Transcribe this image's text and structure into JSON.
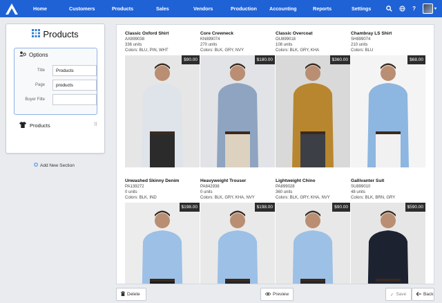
{
  "app": {
    "logo_icon": "app-logo-icon",
    "accent": "#1f62d6"
  },
  "nav": {
    "items": [
      "Home",
      "Customers",
      "Products",
      "Sales",
      "Vendors",
      "Production",
      "Accounting",
      "Reports",
      "Settings"
    ]
  },
  "topbar_icons": [
    "search-icon",
    "globe-icon",
    "help-icon"
  ],
  "panel": {
    "title": "Products",
    "options_label": "Options",
    "fields": [
      {
        "label": "Title",
        "value": "Products"
      },
      {
        "label": "Page",
        "value": "products"
      },
      {
        "label": "Buyer Filte",
        "value": ""
      }
    ],
    "section_label": "Products",
    "add_section": "Add New Section"
  },
  "products": [
    {
      "name": "Classic Oxford Shirt",
      "sku": "AX899038",
      "units": "336 units",
      "colors": "Colors: BLU, PIN, WHT",
      "price": "$90.00",
      "top": "#dfe3ea",
      "bottom": "#2b2b2b",
      "bg": "#e6e6e6"
    },
    {
      "name": "Core Crewneck",
      "sku": "KN899074",
      "units": "270 units",
      "colors": "Colors: BLK, GRY, NVY",
      "price": "$180.00",
      "top": "#8ea4c0",
      "bottom": "#ddd2c0",
      "bg": "#e2e3e6"
    },
    {
      "name": "Classic Overcoat",
      "sku": "OU899018",
      "units": "108 units",
      "colors": "Colors: BLK, GRY, KHA",
      "price": "$360.00",
      "top": "#b8862e",
      "bottom": "#3c3f45",
      "bg": "#d9d9d9"
    },
    {
      "name": "Chambray LS Shirt",
      "sku": "SH899074",
      "units": "210 units",
      "colors": "Colors: BLU",
      "price": "$68.00",
      "top": "#8db6e0",
      "bottom": "#f1f1f1",
      "bg": "#f4f4f4"
    },
    {
      "name": "Unwashed Skinny Denim",
      "sku": "PA139272",
      "units": "0 units",
      "colors": "Colors: BLK, IND",
      "price": "$198.00",
      "top": "#9cc0e6",
      "bottom": "#1c1c1e",
      "bg": "#ececec"
    },
    {
      "name": "Heavyweight Trouser",
      "sku": "PA842938",
      "units": "0 units",
      "colors": "Colors: BLK, GRY, KHA, NVY",
      "price": "$198.00",
      "top": "#9cc0e6",
      "bottom": "#232428",
      "bg": "#e9e9e9"
    },
    {
      "name": "Lightweight Chino",
      "sku": "PA899028",
      "units": "360 units",
      "colors": "Colors: BLK, GRY, KHA, NVY",
      "price": "$90.00",
      "top": "#9cc0e6",
      "bottom": "#25262a",
      "bg": "#e8e8e8"
    },
    {
      "name": "Gallivanter Suit",
      "sku": "SU899010",
      "units": "48 units",
      "colors": "Colors: BLK, BRN, GRY",
      "price": "$590.00",
      "top": "#1d2230",
      "bottom": "#1d2230",
      "bg": "#e6e6e6"
    }
  ],
  "footer": {
    "delete": "Delete",
    "preview": "Preview",
    "save": "Save",
    "back": "Back"
  }
}
